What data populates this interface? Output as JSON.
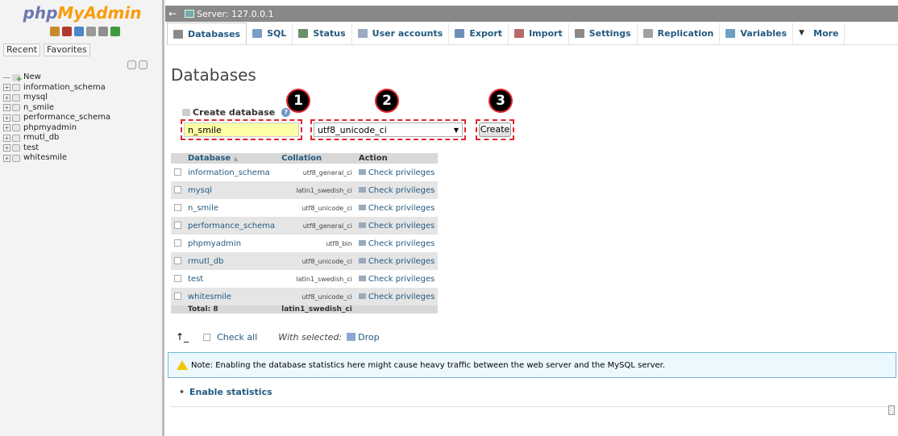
{
  "nav": {
    "logo_php": "php",
    "logo_myadmin": "MyAdmin",
    "icons": [
      {
        "name": "home-icon",
        "color": "#c98a2e"
      },
      {
        "name": "logout-icon",
        "color": "#b03a2e"
      },
      {
        "name": "help-icon",
        "color": "#4b86c6"
      },
      {
        "name": "docs-icon",
        "color": "#999999"
      },
      {
        "name": "settings-icon",
        "color": "#8f8f8f"
      },
      {
        "name": "reload-icon",
        "color": "#3d9b3d"
      }
    ],
    "recent_tab": "Recent",
    "favorites_tab": "Favorites",
    "tree": [
      {
        "label": "New",
        "type": "new"
      },
      {
        "label": "information_schema",
        "type": "db"
      },
      {
        "label": "mysql",
        "type": "db"
      },
      {
        "label": "n_smile",
        "type": "db"
      },
      {
        "label": "performance_schema",
        "type": "db"
      },
      {
        "label": "phpmyadmin",
        "type": "db"
      },
      {
        "label": "rmutl_db",
        "type": "db"
      },
      {
        "label": "test",
        "type": "db"
      },
      {
        "label": "whitesmile",
        "type": "db"
      }
    ]
  },
  "topbar": {
    "server_label": "Server: 127.0.0.1"
  },
  "menu": {
    "tabs": [
      {
        "label": "Databases",
        "icon": "database-icon",
        "color": "#8a8a8a",
        "active": true
      },
      {
        "label": "SQL",
        "icon": "sql-icon",
        "color": "#7a9cc6"
      },
      {
        "label": "Status",
        "icon": "status-icon",
        "color": "#6b8e6b"
      },
      {
        "label": "User accounts",
        "icon": "users-icon",
        "color": "#9aaac0"
      },
      {
        "label": "Export",
        "icon": "export-icon",
        "color": "#6f8fb8"
      },
      {
        "label": "Import",
        "icon": "import-icon",
        "color": "#b76a6a"
      },
      {
        "label": "Settings",
        "icon": "wrench-icon",
        "color": "#8a8a8a"
      },
      {
        "label": "Replication",
        "icon": "replication-icon",
        "color": "#a0a0a0"
      },
      {
        "label": "Variables",
        "icon": "variables-icon",
        "color": "#6f9fc2"
      },
      {
        "label": "More",
        "icon": "caret-down-icon",
        "color": "#333333"
      }
    ]
  },
  "main": {
    "title": "Databases",
    "create_label": "Create database",
    "db_name_value": "n_smile",
    "collation_value": "utf8_unicode_ci",
    "create_button": "Create",
    "markers": [
      "1",
      "2",
      "3"
    ],
    "table": {
      "headers": {
        "database": "Database",
        "sort_arrow": "▲",
        "collation": "Collation",
        "action": "Action"
      },
      "rows": [
        {
          "name": "information_schema",
          "collation": "utf8_general_ci",
          "action": "Check privileges"
        },
        {
          "name": "mysql",
          "collation": "latin1_swedish_ci",
          "action": "Check privileges"
        },
        {
          "name": "n_smile",
          "collation": "utf8_unicode_ci",
          "action": "Check privileges"
        },
        {
          "name": "performance_schema",
          "collation": "utf8_general_ci",
          "action": "Check privileges"
        },
        {
          "name": "phpmyadmin",
          "collation": "utf8_bin",
          "action": "Check privileges"
        },
        {
          "name": "rmutl_db",
          "collation": "utf8_unicode_ci",
          "action": "Check privileges"
        },
        {
          "name": "test",
          "collation": "latin1_swedish_ci",
          "action": "Check privileges"
        },
        {
          "name": "whitesmile",
          "collation": "utf8_unicode_ci",
          "action": "Check privileges"
        }
      ],
      "total_label": "Total: 8",
      "total_collation": "latin1_swedish_ci"
    },
    "check_all": "Check all",
    "with_selected": "With selected:",
    "drop": "Drop",
    "notice": "Note: Enabling the database statistics here might cause heavy traffic between the web server and the MySQL server.",
    "enable_statistics": "Enable statistics"
  }
}
